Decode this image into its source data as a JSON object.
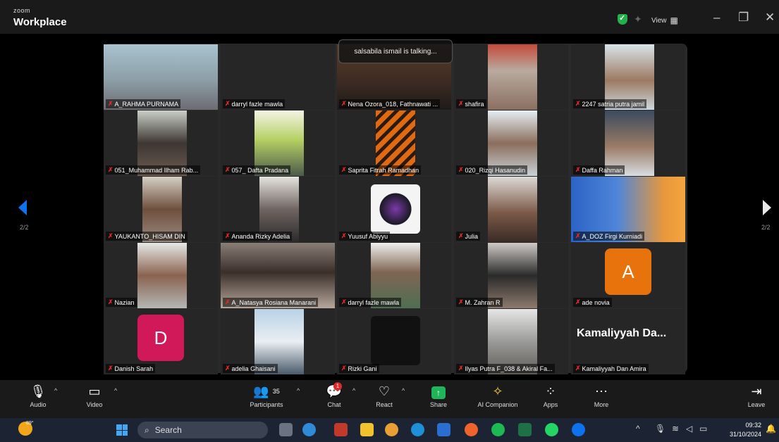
{
  "titlebar": {
    "brand_small": "zoom",
    "brand_big": "Workplace",
    "view_label": "View",
    "minimize": "–",
    "restore": "❐",
    "close": "✕"
  },
  "talking_banner": "salsabila ismail is talking...",
  "page_indicator_left": "2/2",
  "page_indicator_right": "2/2",
  "tiles": [
    {
      "name": "A_RAHMA PURNAMA",
      "kind": "video"
    },
    {
      "name": "darryl fazle mawla",
      "kind": "blank"
    },
    {
      "name": "Nena Ozora_018, Fathnawati ...",
      "kind": "video"
    },
    {
      "name": "shafira",
      "kind": "video"
    },
    {
      "name": "2247 satria putra jamil",
      "kind": "video"
    },
    {
      "name": "051_Muhammad Ilham Rab...",
      "kind": "video"
    },
    {
      "name": "057_ Dafta Pradana",
      "kind": "video"
    },
    {
      "name": "Saprita Fitrah Ramadhan",
      "kind": "video"
    },
    {
      "name": "020_Rizqi Hasanudin",
      "kind": "video"
    },
    {
      "name": "Daffa Rahman",
      "kind": "video"
    },
    {
      "name": "YAUKANTO_HISAM DIN",
      "kind": "video"
    },
    {
      "name": "Ananda Rizky Adelia",
      "kind": "video"
    },
    {
      "name": "Yuusuf Abiyyu",
      "kind": "video"
    },
    {
      "name": "Julia",
      "kind": "video"
    },
    {
      "name": "A_DOZ Firgi Kurniadi",
      "kind": "video"
    },
    {
      "name": "Nazian",
      "kind": "video"
    },
    {
      "name": "A_Natasya Rosiana Manarani",
      "kind": "video"
    },
    {
      "name": "darryl fazle mawla",
      "kind": "video"
    },
    {
      "name": "M. Zahran R",
      "kind": "video"
    },
    {
      "name": "ade novia",
      "kind": "avatar",
      "initial": "A",
      "color": "#e8720c"
    },
    {
      "name": "Danish Sarah",
      "kind": "avatar",
      "initial": "D",
      "color": "#d1195a"
    },
    {
      "name": "adelia Ghaisani",
      "kind": "video"
    },
    {
      "name": "Rizki Gani",
      "kind": "video"
    },
    {
      "name": "Ilyas Putra F_038 & Akiral Fa...",
      "kind": "video"
    },
    {
      "name": "Kamaliyyah Dan Amira",
      "kind": "text",
      "display": "Kamaliyyah Da..."
    }
  ],
  "toolbar": {
    "audio": "Audio",
    "video": "Video",
    "participants": "Participants",
    "participants_count": "35",
    "chat": "Chat",
    "chat_badge": "1",
    "react": "React",
    "share": "Share",
    "ai_companion": "AI Companion",
    "apps": "Apps",
    "more": "More",
    "leave": "Leave"
  },
  "taskbar": {
    "weather": "89°",
    "search_placeholder": "Search",
    "time": "09:32",
    "date": "31/10/2024"
  },
  "colors": {
    "zoom_blue": "#0e72ed",
    "share_green": "#20b55a",
    "leave_red": "#ff5a5a"
  }
}
